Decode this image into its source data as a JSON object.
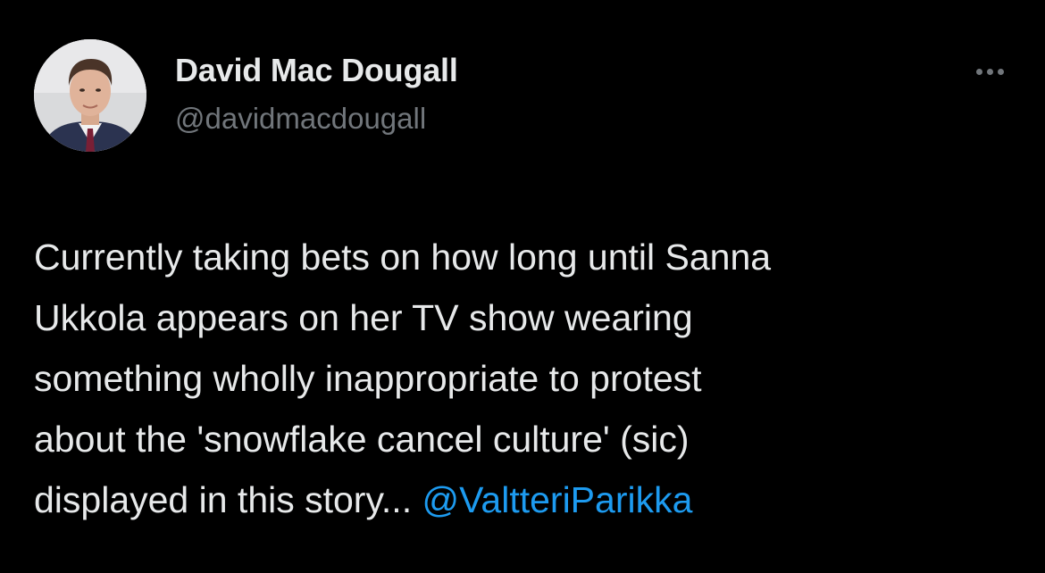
{
  "tweet": {
    "author": {
      "display_name": "David Mac Dougall",
      "handle": "@davidmacdougall"
    },
    "body_lines": [
      "Currently taking bets on how long until Sanna",
      "Ukkola appears on her TV show wearing",
      "something wholly inappropriate to protest",
      "about the 'snowflake cancel culture' (sic)",
      "displayed in this story..."
    ],
    "mention": "@ValtteriParikka",
    "more_icon": "more-horizontal-icon"
  },
  "colors": {
    "background": "#000000",
    "text_primary": "#e7e9ea",
    "text_secondary": "#71767b",
    "link": "#1d9bf0"
  }
}
